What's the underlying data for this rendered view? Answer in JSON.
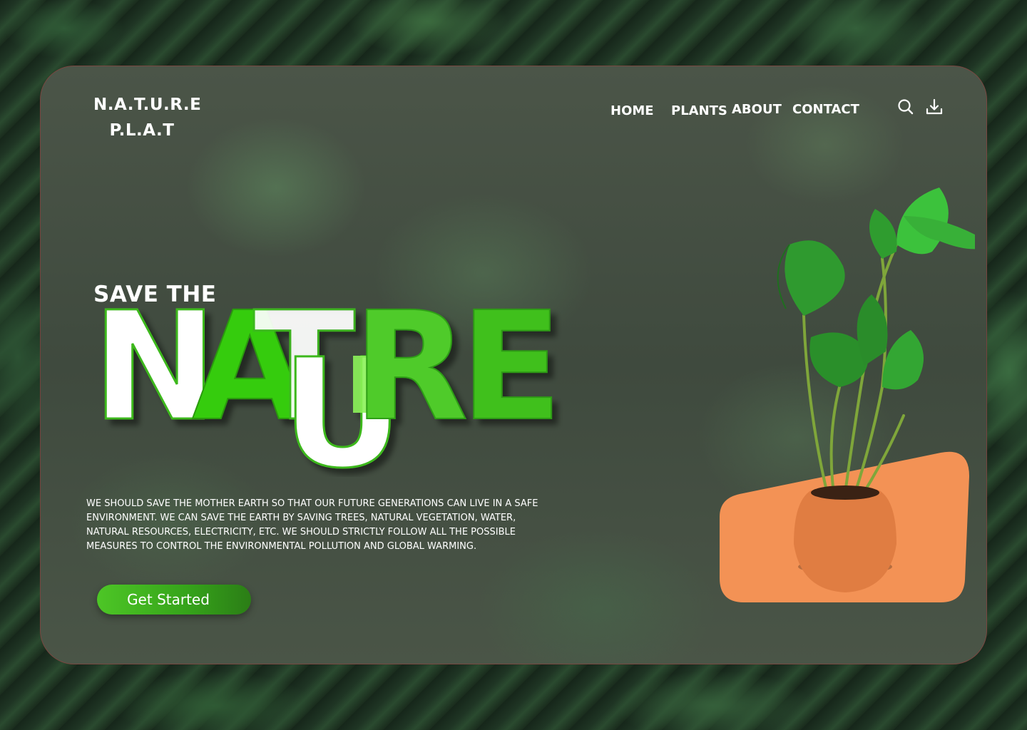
{
  "brand": {
    "line1": "N.A.T.U.R.E",
    "line2": "P.L.A.T"
  },
  "nav": [
    {
      "label": "HOME"
    },
    {
      "label": "PLANTS"
    },
    {
      "label": "ABOUT"
    },
    {
      "label": "CONTACT"
    }
  ],
  "icons": {
    "search": "search-icon",
    "download": "download-icon"
  },
  "hero": {
    "eyebrow": "SAVE THE",
    "letters": [
      "N",
      "A",
      "T",
      "U",
      "R",
      "E"
    ],
    "description": "WE SHOULD SAVE THE MOTHER EARTH SO THAT OUR FUTURE GENERATIONS CAN LIVE IN A SAFE ENVIRONMENT. WE CAN SAVE THE EARTH BY SAVING TREES, NATURAL VEGETATION, WATER, NATURAL RESOURCES, ELECTRICITY, ETC. WE SHOULD STRICTLY FOLLOW ALL THE POSSIBLE MEASURES TO CONTROL THE ENVIRONMENTAL POLLUTION AND GLOBAL WARMING.",
    "cta_label": "Get Started"
  },
  "colors": {
    "accent_green": "#4dc626",
    "bright_green": "#36cc10",
    "light_green": "#8cf25a",
    "pot_orange": "#f39255",
    "text": "#ffffff"
  }
}
